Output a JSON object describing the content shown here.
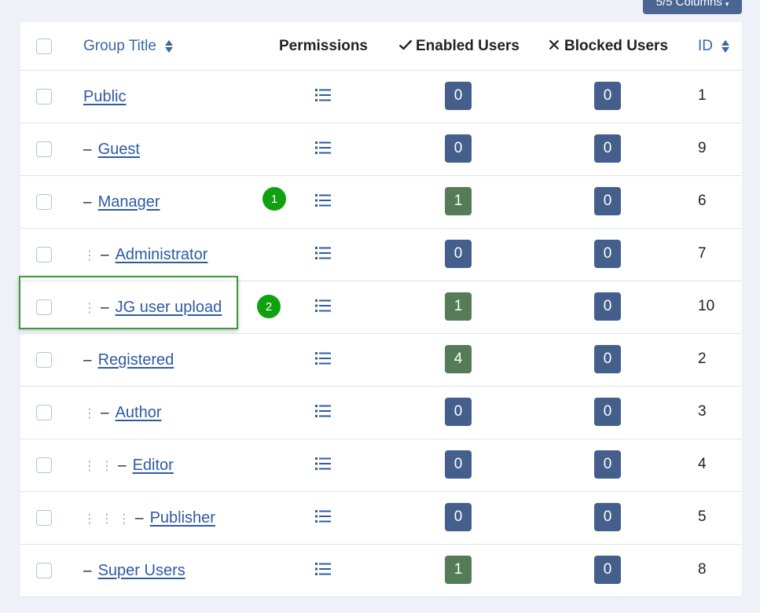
{
  "toolbar": {
    "columns_label": "5/5 Columns"
  },
  "table": {
    "headers": {
      "group_title": "Group Title",
      "permissions": "Permissions",
      "enabled_users": "Enabled Users",
      "blocked_users": "Blocked Users",
      "id": "ID"
    },
    "rows": [
      {
        "title": "Public",
        "level": 0,
        "enabled": "0",
        "blocked": "0",
        "id": "1"
      },
      {
        "title": "Guest",
        "level": 1,
        "enabled": "0",
        "blocked": "0",
        "id": "9"
      },
      {
        "title": "Manager",
        "level": 1,
        "enabled": "1",
        "blocked": "0",
        "id": "6"
      },
      {
        "title": "Administrator",
        "level": 2,
        "enabled": "0",
        "blocked": "0",
        "id": "7"
      },
      {
        "title": "JG user upload",
        "level": 2,
        "enabled": "1",
        "blocked": "0",
        "id": "10"
      },
      {
        "title": "Registered",
        "level": 1,
        "enabled": "4",
        "blocked": "0",
        "id": "2"
      },
      {
        "title": "Author",
        "level": 2,
        "enabled": "0",
        "blocked": "0",
        "id": "3"
      },
      {
        "title": "Editor",
        "level": 3,
        "enabled": "0",
        "blocked": "0",
        "id": "4"
      },
      {
        "title": "Publisher",
        "level": 4,
        "enabled": "0",
        "blocked": "0",
        "id": "5"
      },
      {
        "title": "Super Users",
        "level": 1,
        "enabled": "1",
        "blocked": "0",
        "id": "8"
      }
    ]
  },
  "annotations": {
    "marker_1": "1",
    "marker_2": "2"
  },
  "colors": {
    "link": "#2e5aa3",
    "badge_zero": "#455f8c",
    "badge_nonzero": "#557c57",
    "marker": "#10a010",
    "highlight_border": "#3a9b3a"
  },
  "icons": {
    "permissions": "list-icon",
    "enabled_header": "check-icon",
    "blocked_header": "close-icon",
    "sort": "sort-icon"
  }
}
